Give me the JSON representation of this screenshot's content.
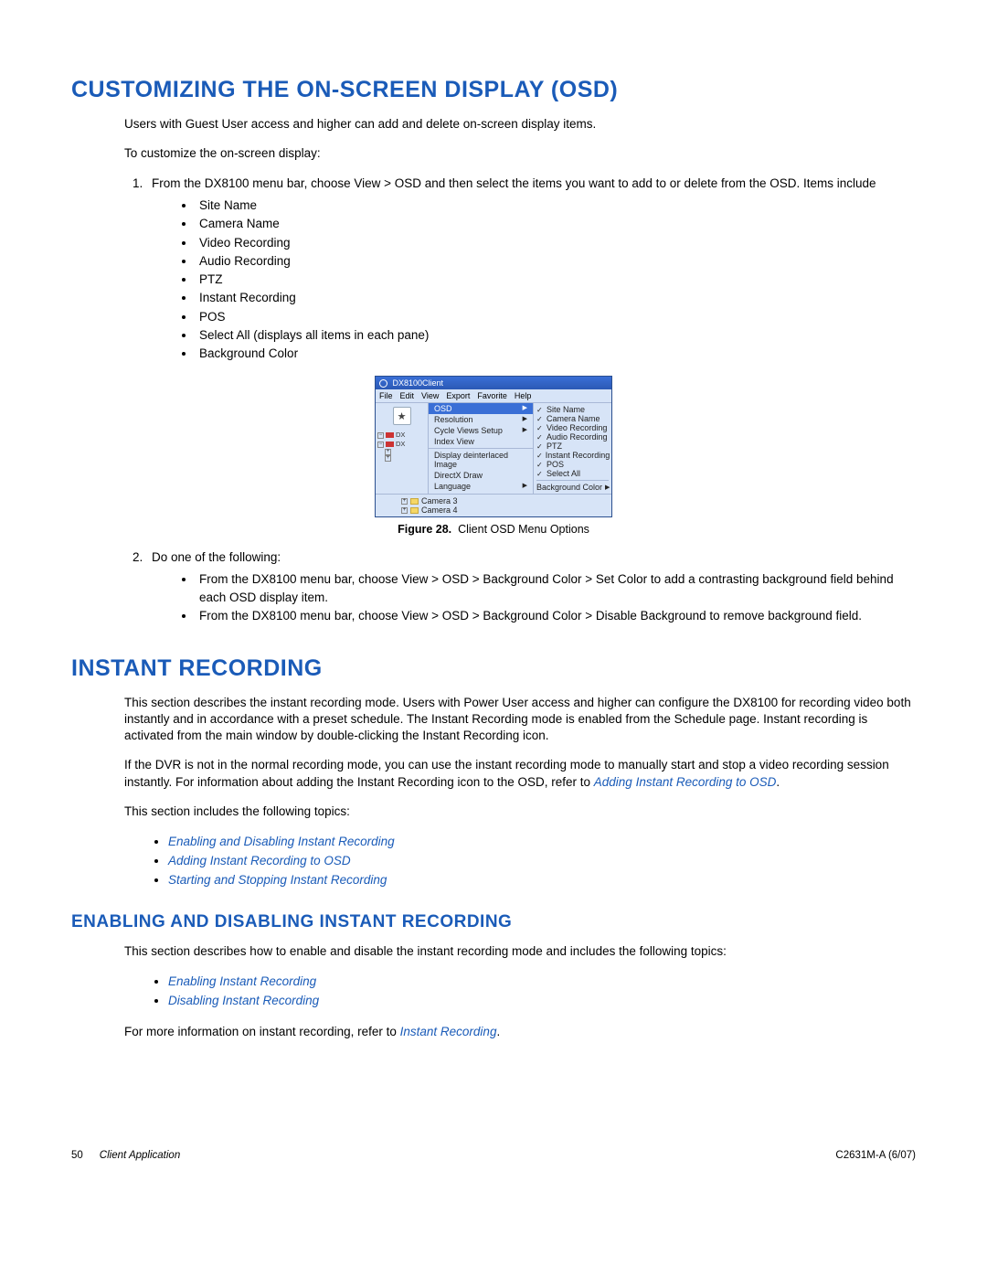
{
  "section1": {
    "title": "CUSTOMIZING THE ON-SCREEN DISPLAY (OSD)",
    "p1": "Users with Guest User access and higher can add and delete on-screen display items.",
    "p2": "To customize the on-screen display:",
    "step1": "From the DX8100 menu bar, choose View > OSD and then select the items you want to add to or delete from the OSD. Items include",
    "items": [
      "Site Name",
      "Camera Name",
      "Video Recording",
      "Audio Recording",
      "PTZ",
      "Instant Recording",
      "POS",
      "Select All (displays all items in each pane)",
      "Background Color"
    ],
    "figure_label": "Figure 28.",
    "figure_caption": "Client OSD Menu Options",
    "step2": "Do one of the following:",
    "step2a": "From the DX8100 menu bar, choose View > OSD > Background Color > Set Color to add a contrasting background field behind each OSD display item.",
    "step2b": "From the DX8100 menu bar, choose View > OSD > Background Color > Disable Background to remove background field."
  },
  "osd": {
    "title": "DX8100Client",
    "menubar": [
      "File",
      "Edit",
      "View",
      "Export",
      "Favorite",
      "Help"
    ],
    "tree": {
      "d1": "DX",
      "d2": "DX"
    },
    "mid": {
      "osd": "OSD",
      "res": "Resolution",
      "cycle": "Cycle Views Setup",
      "index": "Index View",
      "deint": "Display deinterlaced Image",
      "ddraw": "DirectX Draw",
      "lang": "Language"
    },
    "right": {
      "site": "Site Name",
      "cam": "Camera Name",
      "vid": "Video Recording",
      "aud": "Audio Recording",
      "ptz": "PTZ",
      "inst": "Instant Recording",
      "pos": "POS",
      "sel": "Select All",
      "bg": "Background Color"
    },
    "bottom": {
      "c3": "Camera 3",
      "c4": "Camera 4"
    }
  },
  "section2": {
    "title": "INSTANT RECORDING",
    "p1": "This section describes the instant recording mode. Users with Power User access and higher can configure the DX8100 for recording video both instantly and in accordance with a preset schedule. The Instant Recording mode is enabled from the Schedule page. Instant recording is activated from the main window by double-clicking the Instant Recording icon.",
    "p2a": "If the DVR is not in the normal recording mode, you can use the instant recording mode to manually start and stop a video recording session instantly. For information about adding the Instant Recording icon to the OSD, refer to ",
    "p2link": "Adding Instant Recording to OSD",
    "p3": "This section includes the following topics:",
    "links": [
      "Enabling and Disabling Instant Recording",
      "Adding Instant Recording to OSD",
      "Starting and Stopping Instant Recording"
    ],
    "sub": {
      "title": "ENABLING AND DISABLING INSTANT RECORDING",
      "p1": "This section describes how to enable and disable the instant recording mode and includes the following topics:",
      "links": [
        "Enabling Instant Recording",
        "Disabling Instant Recording"
      ],
      "p2a": "For more information on instant recording, refer to ",
      "p2link": "Instant Recording"
    }
  },
  "footer": {
    "page": "50",
    "section": "Client Application",
    "doc": "C2631M-A (6/07)"
  }
}
